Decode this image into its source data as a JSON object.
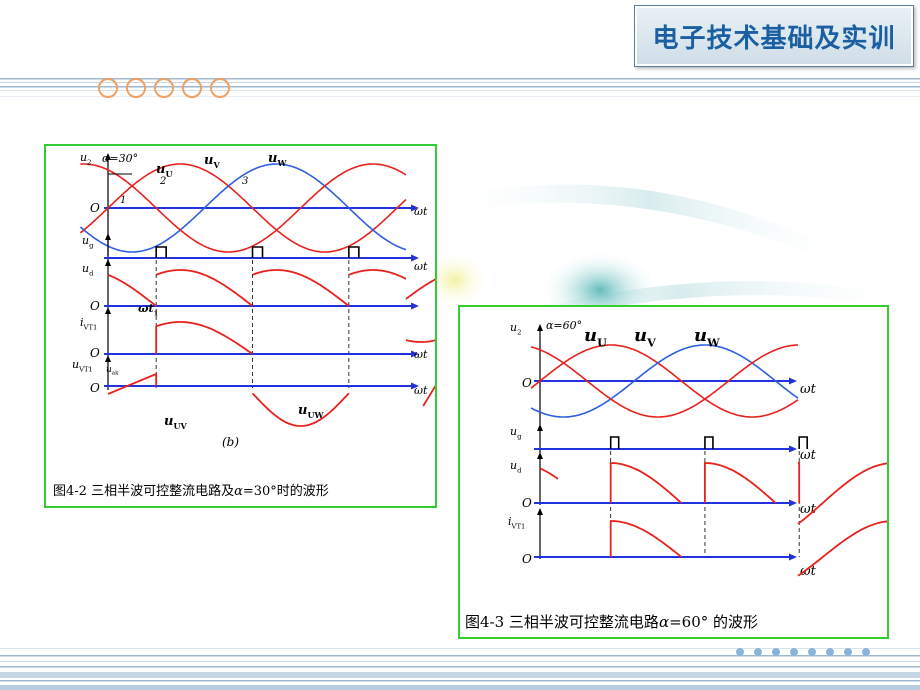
{
  "header": {
    "title": "电子技术基础及实训",
    "decor_circles": 5
  },
  "figure_42": {
    "caption_prefix": "图4-2  三相半波可控整流电路及",
    "caption_symbol": "α",
    "caption_suffix": "=30°时的波形",
    "panel_label": "(b)",
    "alpha_label": "α=30°",
    "point_labels": [
      "1",
      "2",
      "3"
    ],
    "curve_labels": {
      "u": "u",
      "u_sub": "U",
      "v": "u",
      "v_sub": "V",
      "w": "u",
      "w_sub": "W"
    },
    "axis_labels": {
      "u2": "u",
      "u2_sub": "2",
      "ug": "u",
      "ug_sub": "g",
      "ud": "u",
      "ud_sub": "d",
      "ivt": "i",
      "ivt_sub": "VT1",
      "uvt": "u",
      "uvt_sub": "VT1",
      "origin": "O",
      "wt": "ωt"
    },
    "annotations": {
      "wt1": "ωt",
      "wt1_sub": "1",
      "uuv": "u",
      "uuv_sub": "UV",
      "uuw": "u",
      "uuw_sub": "UW",
      "uak": "u",
      "uak_sub": "ak"
    }
  },
  "figure_43": {
    "caption_prefix": "图4-3  三相半波可控整流电路",
    "caption_symbol": "α",
    "caption_suffix": "=60°  的波形",
    "alpha_label": "α=60°",
    "curve_labels": {
      "u": "u",
      "u_sub": "U",
      "v": "u",
      "v_sub": "V",
      "w": "u",
      "w_sub": "W"
    },
    "axis_labels": {
      "u2": "u",
      "u2_sub": "2",
      "ug": "u",
      "ug_sub": "g",
      "ud": "u",
      "ud_sub": "d",
      "ivt": "i",
      "ivt_sub": "VT1",
      "origin": "O",
      "wt": "ωt"
    }
  },
  "colors": {
    "frame": "#33cc33",
    "phase_red": "#e8211e",
    "phase_blue": "#2f5fe0",
    "axis_blue": "#2233dd",
    "title_blue": "#1a5fa2",
    "decor_orange": "#f0a060",
    "decor_dots": "#8ab4dc"
  }
}
